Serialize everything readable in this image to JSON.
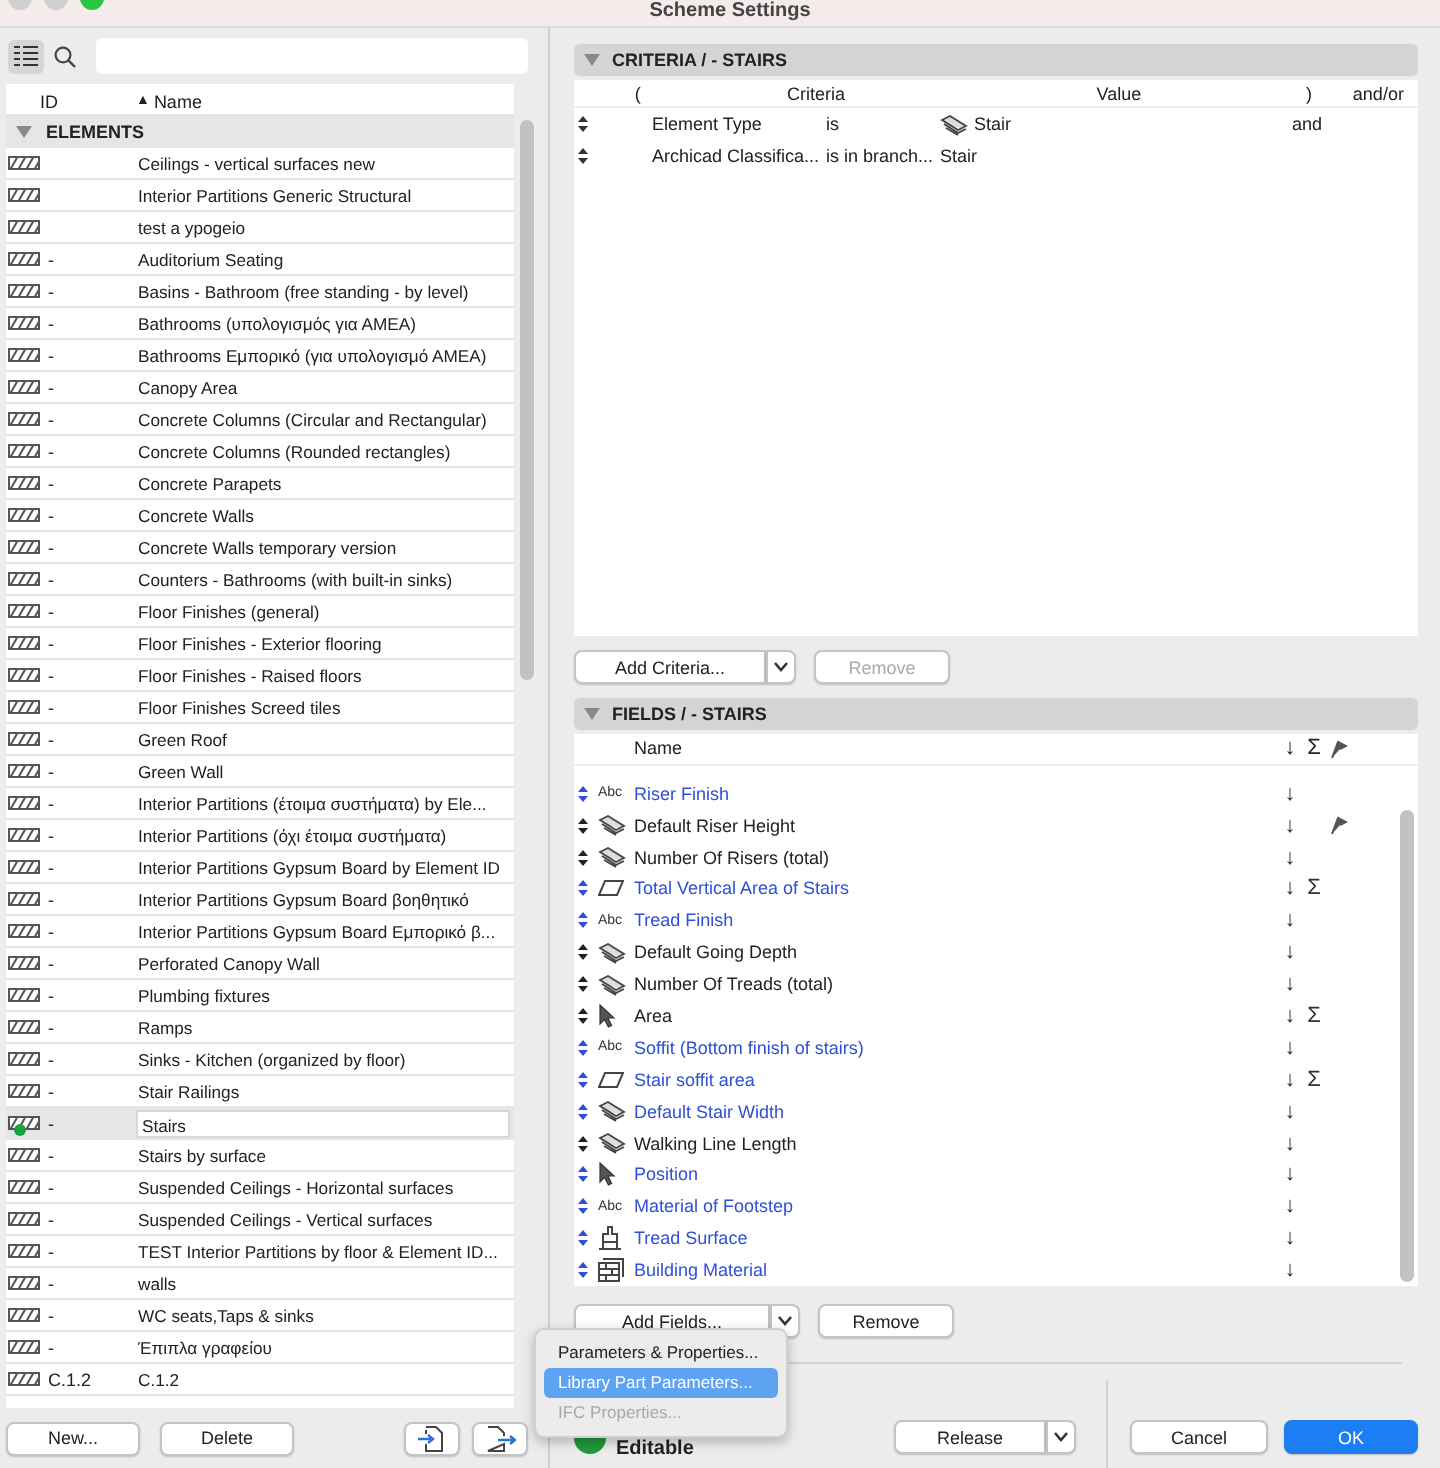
{
  "window": {
    "title": "Scheme Settings"
  },
  "toolbar": {
    "list_view_selected": true
  },
  "list": {
    "columns": [
      {
        "label": "ID"
      },
      {
        "label": "Name",
        "sort": "▲"
      }
    ],
    "group": {
      "label": "ELEMENTS",
      "expanded": true
    },
    "rows": [
      {
        "name": "Ceilings - vertical surfaces new",
        "selected": false,
        "status_dot": false
      },
      {
        "name": "Interior Partitions Generic Structural",
        "selected": false,
        "status_dot": false
      },
      {
        "name": "test a ypogeio",
        "selected": false,
        "status_dot": false
      },
      {
        "id": "-",
        "name": "Auditorium Seating",
        "selected": false,
        "status_dot": false
      },
      {
        "id": "-",
        "name": "Basins - Bathroom (free standing - by level)",
        "selected": false,
        "status_dot": false
      },
      {
        "id": "-",
        "name": "Bathrooms (υπολογισμός για ΑΜΕΑ)",
        "selected": false,
        "status_dot": false
      },
      {
        "id": "-",
        "name": "Bathrooms Εμπορικό (για υπολογισμό ΑΜΕΑ)",
        "selected": false,
        "status_dot": false
      },
      {
        "id": "-",
        "name": "Canopy Area",
        "selected": false,
        "status_dot": false
      },
      {
        "id": "-",
        "name": "Concrete Columns (Circular and Rectangular)",
        "selected": false,
        "status_dot": false
      },
      {
        "id": "-",
        "name": "Concrete Columns (Rounded rectangles)",
        "selected": false,
        "status_dot": false
      },
      {
        "id": "-",
        "name": "Concrete Parapets",
        "selected": false,
        "status_dot": false
      },
      {
        "id": "-",
        "name": "Concrete Walls",
        "selected": false,
        "status_dot": false
      },
      {
        "id": "-",
        "name": "Concrete Walls temporary version",
        "selected": false,
        "status_dot": false
      },
      {
        "id": "-",
        "name": "Counters - Bathrooms (with built-in sinks)",
        "selected": false,
        "status_dot": false
      },
      {
        "id": "-",
        "name": "Floor Finishes (general)",
        "selected": false,
        "status_dot": false
      },
      {
        "id": "-",
        "name": "Floor Finishes - Exterior flooring",
        "selected": false,
        "status_dot": false
      },
      {
        "id": "-",
        "name": "Floor Finishes - Raised floors",
        "selected": false,
        "status_dot": false
      },
      {
        "id": "-",
        "name": "Floor Finishes Screed tiles",
        "selected": false,
        "status_dot": false
      },
      {
        "id": "-",
        "name": "Green Roof",
        "selected": false,
        "status_dot": false
      },
      {
        "id": "-",
        "name": "Green Wall",
        "selected": false,
        "status_dot": false
      },
      {
        "id": "-",
        "name": "Interior Partitions (έτοιμα συστήματα) by Ele...",
        "selected": false,
        "status_dot": false
      },
      {
        "id": "-",
        "name": "Interior Partitions (όχι έτοιμα συστήματα)",
        "selected": false,
        "status_dot": false
      },
      {
        "id": "-",
        "name": "Interior Partitions Gypsum Board by Element ID",
        "selected": false,
        "status_dot": false
      },
      {
        "id": "-",
        "name": "Interior Partitions Gypsum Board βοηθητικό",
        "selected": false,
        "status_dot": false
      },
      {
        "id": "-",
        "name": "Interior Partitions Gypsum Board Εμπορικό β...",
        "selected": false,
        "status_dot": false
      },
      {
        "id": "-",
        "name": "Perforated Canopy Wall",
        "selected": false,
        "status_dot": false
      },
      {
        "id": "-",
        "name": "Plumbing fixtures",
        "selected": false,
        "status_dot": false
      },
      {
        "id": "-",
        "name": "Ramps",
        "selected": false,
        "status_dot": false
      },
      {
        "id": "-",
        "name": "Sinks - Kitchen (organized by floor)",
        "selected": false,
        "status_dot": false
      },
      {
        "id": "-",
        "name": "Stair Railings",
        "selected": false,
        "status_dot": false
      },
      {
        "id": "-",
        "name": "Stairs",
        "selected": true,
        "status_dot": true
      },
      {
        "id": "-",
        "name": "Stairs by surface",
        "selected": false,
        "status_dot": false
      },
      {
        "id": "-",
        "name": "Suspended Ceilings - Horizontal surfaces",
        "selected": false,
        "status_dot": false
      },
      {
        "id": "-",
        "name": "Suspended Ceilings - Vertical surfaces",
        "selected": false,
        "status_dot": false
      },
      {
        "id": "-",
        "name": "TEST Interior Partitions by floor & Element ID...",
        "selected": false,
        "status_dot": false
      },
      {
        "id": "-",
        "name": "walls",
        "selected": false,
        "status_dot": false
      },
      {
        "id": "-",
        "name": "WC seats,Taps & sinks",
        "selected": false,
        "status_dot": false
      },
      {
        "id": "-",
        "name": "Έπιπλα γραφείου",
        "selected": false,
        "status_dot": false
      },
      {
        "id": "C.1.2",
        "name": "C.1.2",
        "selected": false,
        "status_dot": false
      }
    ],
    "buttons": [
      {
        "kind": "text",
        "label": "New..."
      },
      {
        "kind": "text",
        "label": "Delete"
      },
      {
        "kind": "import"
      },
      {
        "kind": "export"
      }
    ]
  },
  "criteria": {
    "title": "CRITERIA / - STAIRS",
    "expanded": true,
    "columns": [
      "(",
      "Criteria",
      "Value",
      ")",
      "and/or"
    ],
    "rows": [
      {
        "kind": "icon_value",
        "criterion": "Element Type",
        "operator": "is",
        "value": "Stair",
        "conjunction": "and"
      },
      {
        "kind": "plain",
        "criterion": "Archicad Classifica...",
        "operator": "is in branch...",
        "value": "Stair"
      }
    ],
    "add_button": "Add Criteria...",
    "remove_button": {
      "label": "Remove",
      "disabled": true
    }
  },
  "fields": {
    "title": "FIELDS / - STAIRS",
    "expanded": true,
    "columns": [
      "Name",
      "↓",
      "Σ"
    ],
    "rows": [
      {
        "kind": "text",
        "icon_label": "Abc",
        "name": "Riser Finish",
        "color": "#2f4fd8",
        "sort": "↓",
        "flag": false
      },
      {
        "kind": "stair",
        "name": "Default Riser Height",
        "color": "#222222",
        "sort": "↓",
        "flag": true
      },
      {
        "kind": "stair",
        "name": "Number Of Risers (total)",
        "color": "#222222",
        "sort": "↓",
        "flag": false
      },
      {
        "kind": "area",
        "name": "Total Vertical Area of Stairs",
        "color": "#2f4fd8",
        "sort": "↓",
        "sum": "Σ",
        "flag": false
      },
      {
        "kind": "text",
        "icon_label": "Abc",
        "name": "Tread Finish",
        "color": "#2f4fd8",
        "sort": "↓",
        "flag": false
      },
      {
        "kind": "stair",
        "name": "Default Going Depth",
        "color": "#222222",
        "sort": "↓",
        "flag": false
      },
      {
        "kind": "stair",
        "name": "Number Of Treads (total)",
        "color": "#222222",
        "sort": "↓",
        "flag": false
      },
      {
        "kind": "pointer",
        "name": "Area",
        "color": "#222222",
        "sort": "↓",
        "sum": "Σ",
        "flag": false
      },
      {
        "kind": "text",
        "icon_label": "Abc",
        "name": "Soffit (Bottom finish of stairs)",
        "color": "#2f4fd8",
        "sort": "↓",
        "flag": false
      },
      {
        "kind": "area",
        "name": "Stair soffit area",
        "color": "#2f4fd8",
        "sort": "↓",
        "sum": "Σ",
        "flag": false
      },
      {
        "kind": "stair",
        "name": "Default Stair Width",
        "color": "#2f4fd8",
        "sort": "↓",
        "flag": false
      },
      {
        "kind": "stair",
        "name": "Walking Line Length",
        "color": "#222222",
        "sort": "↓",
        "flag": false
      },
      {
        "kind": "pointer",
        "name": "Position",
        "color": "#2f4fd8",
        "sort": "↓",
        "flag": false
      },
      {
        "kind": "text",
        "icon_label": "Abc",
        "name": "Material of Footstep",
        "color": "#2f4fd8",
        "sort": "↓",
        "flag": false
      },
      {
        "kind": "surface",
        "name": "Tread Surface",
        "color": "#2f4fd8",
        "sort": "↓",
        "flag": false
      },
      {
        "kind": "material",
        "name": "Building Material",
        "color": "#2f4fd8",
        "sort": "↓",
        "flag": false
      }
    ],
    "add_button": "Add Fields...",
    "remove_button": {
      "label": "Remove",
      "disabled": false
    }
  },
  "menu": {
    "items": [
      {
        "label": "Parameters & Properties...",
        "selected": false,
        "disabled": false
      },
      {
        "label": "Library Part Parameters...",
        "selected": true,
        "disabled": false
      },
      {
        "label": "IFC Properties...",
        "selected": false,
        "disabled": true
      }
    ]
  },
  "footer": {
    "status": "Editable",
    "buttons": [
      {
        "kind": "split",
        "label": "Release"
      },
      {
        "kind": "plain",
        "label": "Cancel"
      },
      {
        "kind": "primary",
        "label": "OK"
      }
    ]
  }
}
